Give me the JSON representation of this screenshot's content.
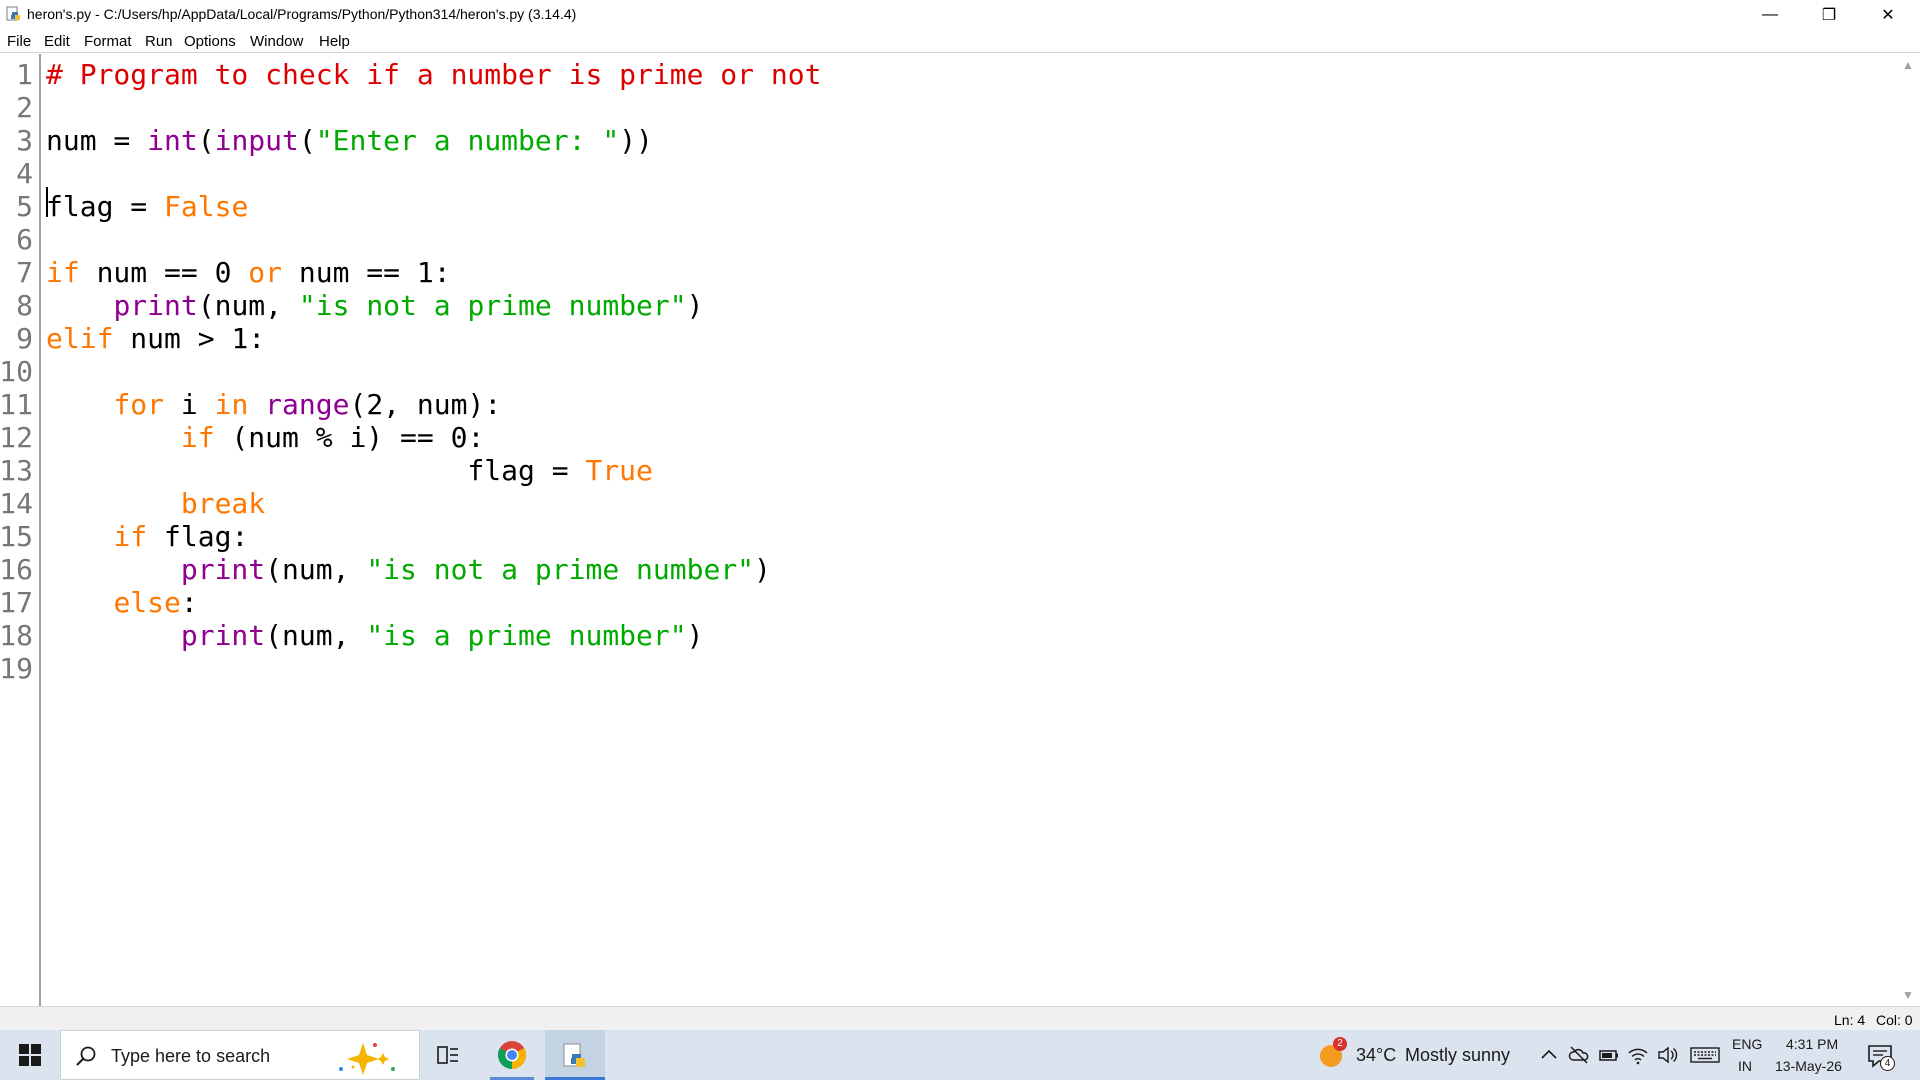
{
  "window": {
    "title": "heron's.py - C:/Users/hp/AppData/Local/Programs/Python/Python314/heron's.py (3.14.4)",
    "minimize": "—",
    "maximize": "❐",
    "close": "✕"
  },
  "menu": {
    "items": [
      "File",
      "Edit",
      "Format",
      "Run",
      "Options",
      "Window",
      "Help"
    ]
  },
  "editor": {
    "line_numbers": [
      "1",
      "2",
      "3",
      "4",
      "5",
      "6",
      "7",
      "8",
      "9",
      "10",
      "11",
      "12",
      "13",
      "14",
      "15",
      "16",
      "17",
      "18",
      "19"
    ],
    "lines": [
      [
        {
          "t": "# Program to check if a number is prime or not",
          "c": "cm"
        }
      ],
      [],
      [
        {
          "t": "num = ",
          "c": ""
        },
        {
          "t": "int",
          "c": "bi"
        },
        {
          "t": "(",
          "c": ""
        },
        {
          "t": "input",
          "c": "bi"
        },
        {
          "t": "(",
          "c": ""
        },
        {
          "t": "\"Enter a number: \"",
          "c": "st"
        },
        {
          "t": "))",
          "c": ""
        }
      ],
      [],
      [
        {
          "t": "flag = ",
          "c": ""
        },
        {
          "t": "False",
          "c": "kw"
        }
      ],
      [],
      [
        {
          "t": "if",
          "c": "kw"
        },
        {
          "t": " num == 0 ",
          "c": ""
        },
        {
          "t": "or",
          "c": "kw"
        },
        {
          "t": " num == 1:",
          "c": ""
        }
      ],
      [
        {
          "t": "    ",
          "c": ""
        },
        {
          "t": "print",
          "c": "bi"
        },
        {
          "t": "(num, ",
          "c": ""
        },
        {
          "t": "\"is not a prime number\"",
          "c": "st"
        },
        {
          "t": ")",
          "c": ""
        }
      ],
      [
        {
          "t": "elif",
          "c": "kw"
        },
        {
          "t": " num > 1:",
          "c": ""
        }
      ],
      [],
      [
        {
          "t": "    ",
          "c": ""
        },
        {
          "t": "for",
          "c": "kw"
        },
        {
          "t": " i ",
          "c": ""
        },
        {
          "t": "in",
          "c": "kw"
        },
        {
          "t": " ",
          "c": ""
        },
        {
          "t": "range",
          "c": "bi"
        },
        {
          "t": "(2, num):",
          "c": ""
        }
      ],
      [
        {
          "t": "        ",
          "c": ""
        },
        {
          "t": "if",
          "c": "kw"
        },
        {
          "t": " (num % i) == 0:",
          "c": ""
        }
      ],
      [
        {
          "t": "                         flag = ",
          "c": ""
        },
        {
          "t": "True",
          "c": "kw"
        }
      ],
      [
        {
          "t": "        ",
          "c": ""
        },
        {
          "t": "break",
          "c": "kw"
        }
      ],
      [
        {
          "t": "    ",
          "c": ""
        },
        {
          "t": "if",
          "c": "kw"
        },
        {
          "t": " flag:",
          "c": ""
        }
      ],
      [
        {
          "t": "        ",
          "c": ""
        },
        {
          "t": "print",
          "c": "bi"
        },
        {
          "t": "(num, ",
          "c": ""
        },
        {
          "t": "\"is not a prime number\"",
          "c": "st"
        },
        {
          "t": ")",
          "c": ""
        }
      ],
      [
        {
          "t": "    ",
          "c": ""
        },
        {
          "t": "else",
          "c": "kw"
        },
        {
          "t": ":",
          "c": ""
        }
      ],
      [
        {
          "t": "        ",
          "c": ""
        },
        {
          "t": "print",
          "c": "bi"
        },
        {
          "t": "(num, ",
          "c": ""
        },
        {
          "t": "\"is a prime number\"",
          "c": "st"
        },
        {
          "t": ")",
          "c": ""
        }
      ],
      []
    ]
  },
  "status": {
    "line": "Ln: 4",
    "col": "Col: 0"
  },
  "taskbar": {
    "search_placeholder": "Type here to search",
    "weather_badge": "2",
    "weather_temp": "34°C",
    "weather_desc": "Mostly sunny",
    "lang_top": "ENG",
    "lang_bottom": "IN",
    "time": "4:31 PM",
    "date": "13-May-26",
    "notification_count": "4"
  },
  "colors": {
    "keyword": "#ff7700",
    "builtin": "#900090",
    "string": "#00aa00",
    "comment": "#dd0000",
    "taskbar": "#dbe4ee"
  },
  "icons": [
    "python-idle-icon",
    "minimize-icon",
    "maximize-icon",
    "close-icon",
    "windows-start-icon",
    "search-icon",
    "copilot-icon",
    "task-view-icon",
    "chrome-icon",
    "python-icon",
    "weather-sun-icon",
    "chevron-up-icon",
    "onedrive-icon",
    "battery-icon",
    "wifi-icon",
    "volume-icon",
    "keyboard-icon",
    "notification-icon"
  ]
}
